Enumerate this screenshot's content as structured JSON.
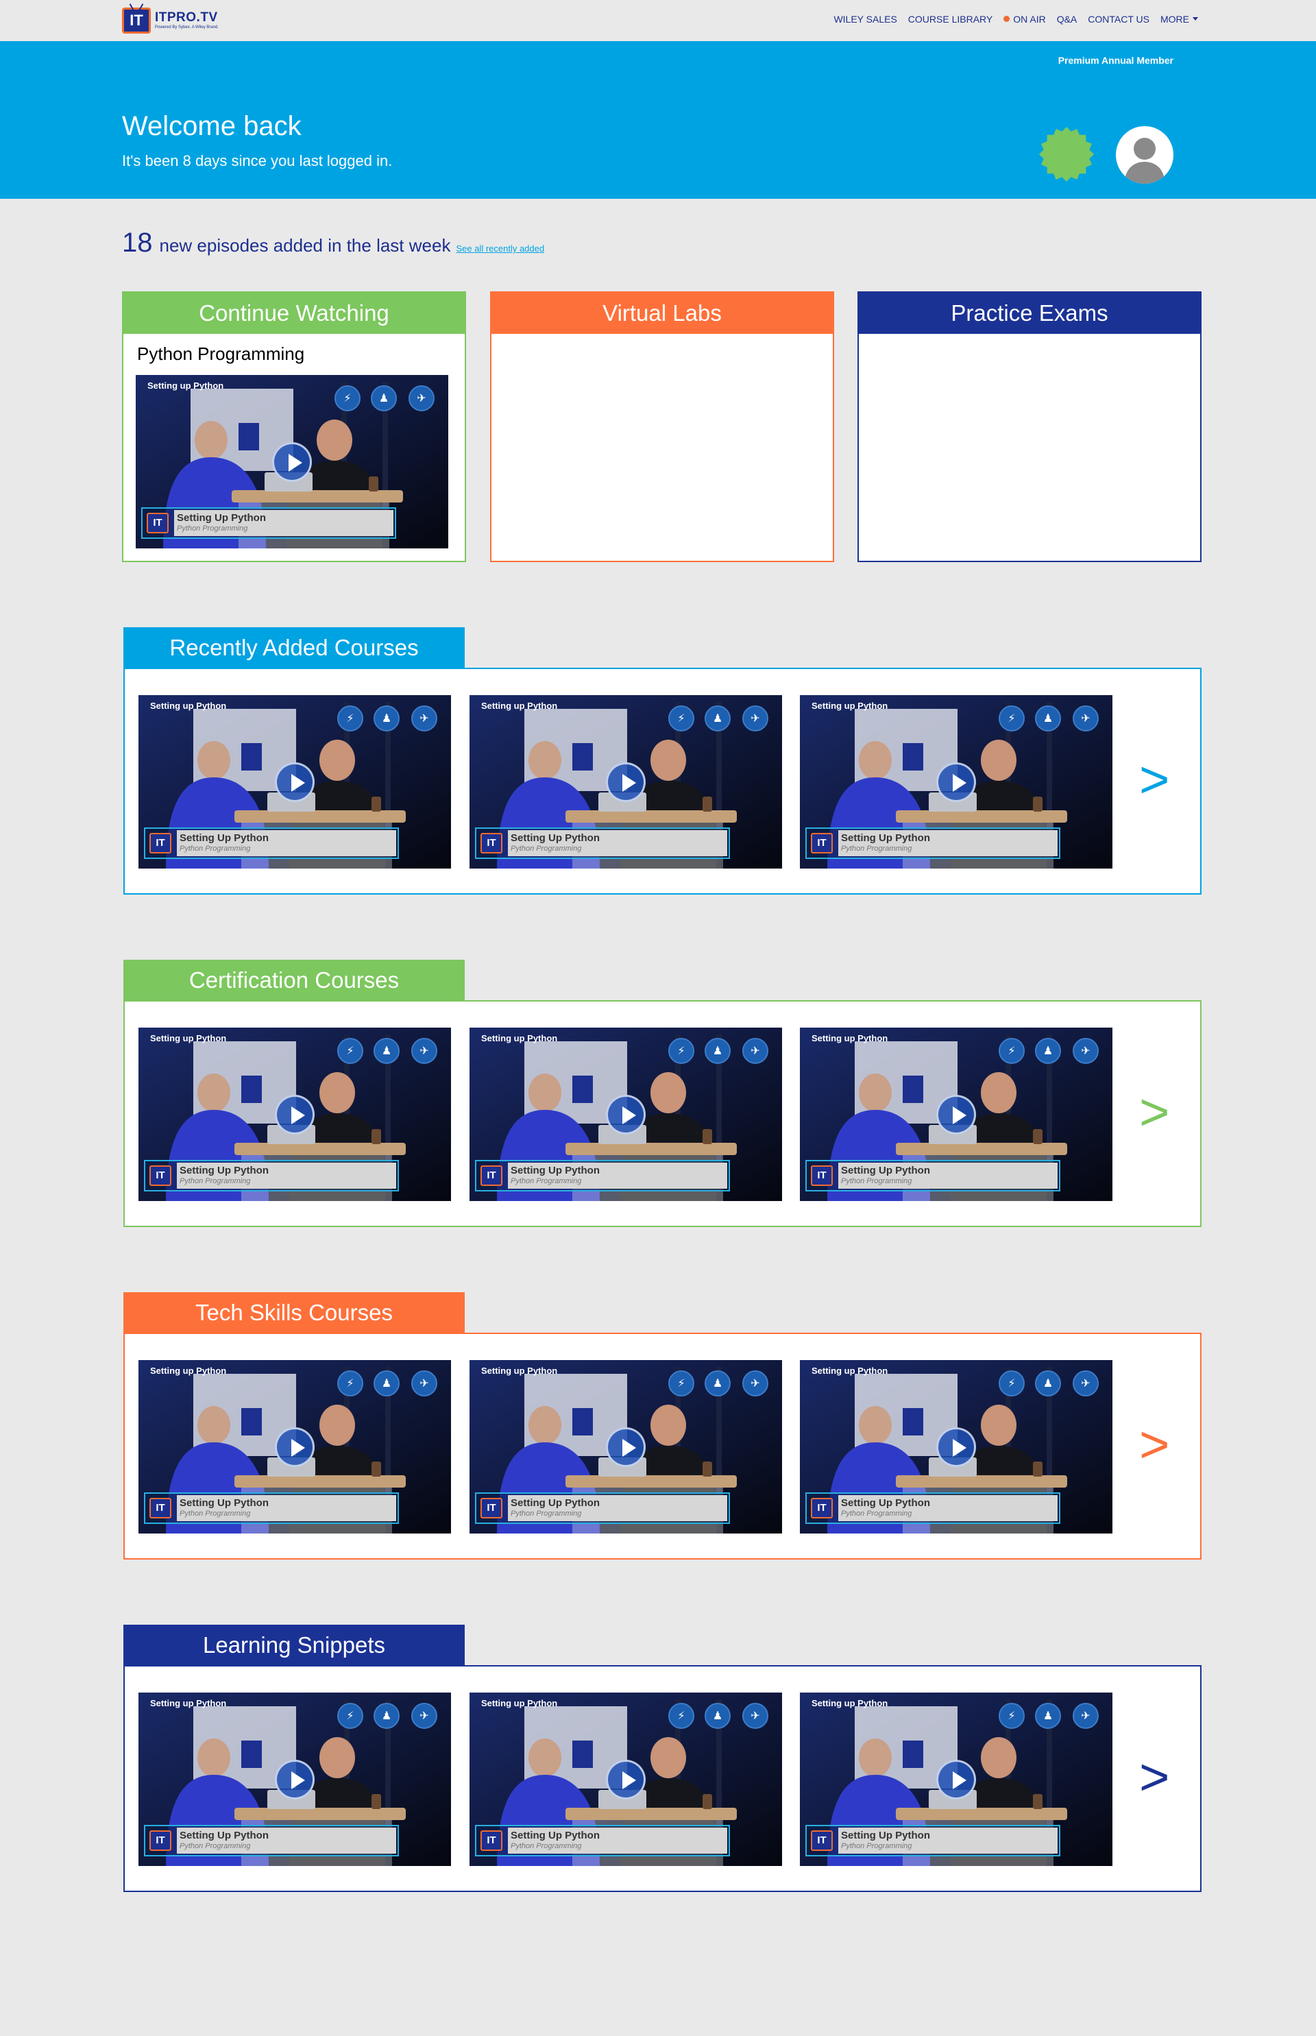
{
  "colors": {
    "blue": "#00a3e2",
    "green": "#7cc75e",
    "orange": "#fe703a",
    "navy": "#1b3295",
    "background": "#e9e9e9"
  },
  "nav": {
    "logo_text": "ITPRO.TV",
    "logo_tagline": "Powered By Sybex. A Wiley Brand.",
    "logo_badge": "IT",
    "links": [
      "WILEY SALES",
      "COURSE LIBRARY",
      "ON AIR",
      "Q&A",
      "CONTACT US",
      "MORE"
    ]
  },
  "hero": {
    "member_label": "Premium Annual Member",
    "welcome": "Welcome back",
    "since": "It's been 8 days since you last logged in.",
    "badge_icon": "award-badge-icon",
    "avatar_icon": "user-avatar-icon"
  },
  "episodes": {
    "count": "18",
    "text": "new episodes added in the last week",
    "link": "See all recently added"
  },
  "cards": {
    "continue": {
      "title": "Continue Watching",
      "course": "Python Programming"
    },
    "labs": {
      "title": "Virtual Labs"
    },
    "exams": {
      "title": "Practice Exams"
    }
  },
  "video": {
    "title": "Setting up Python",
    "lower_main": "Setting Up Python",
    "lower_sub": "Python Programming",
    "lower_badge": "IT",
    "controls": [
      "speed-icon",
      "person-icon",
      "running-icon"
    ]
  },
  "sections": [
    {
      "title": "Recently Added Courses",
      "color": "#00a3e2",
      "next": ">"
    },
    {
      "title": "Certification Courses",
      "color": "#7cc75e",
      "next": ">"
    },
    {
      "title": "Tech Skills Courses",
      "color": "#fe703a",
      "next": ">"
    },
    {
      "title": "Learning Snippets",
      "color": "#1b3295",
      "next": ">"
    }
  ]
}
